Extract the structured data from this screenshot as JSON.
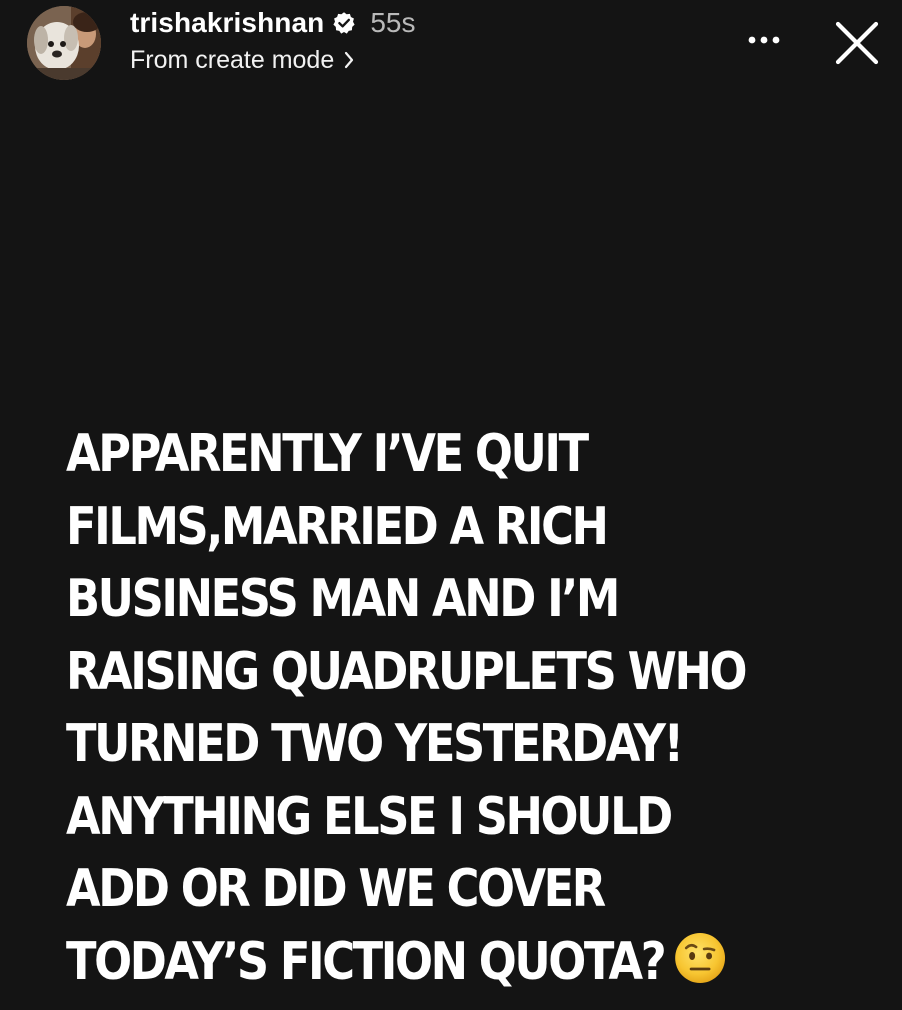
{
  "story": {
    "username": "trishakrishnan",
    "timestamp": "55s",
    "subtitle": "From create mode",
    "verified": true,
    "icons": {
      "avatar": "profile-avatar",
      "verified": "verified-badge-icon",
      "chevron": "chevron-right-icon",
      "more": "more-horizontal-icon",
      "close": "close-icon",
      "emoji": "face-with-raised-eyebrow-emoji"
    },
    "text_lines": [
      "APPARENTLY I’VE QUIT",
      "FILMS,MARRIED A RICH",
      "BUSINESS MAN AND I’M",
      "RAISING QUADRUPLETS WHO",
      "TURNED TWO YESTERDAY!",
      "ANYTHING ELSE I SHOULD",
      "ADD OR DID WE COVER",
      "TODAY’S FICTION QUOTA?"
    ],
    "colors": {
      "background": "#141414",
      "text": "#ffffff",
      "timestamp": "#b9b9b9"
    }
  }
}
